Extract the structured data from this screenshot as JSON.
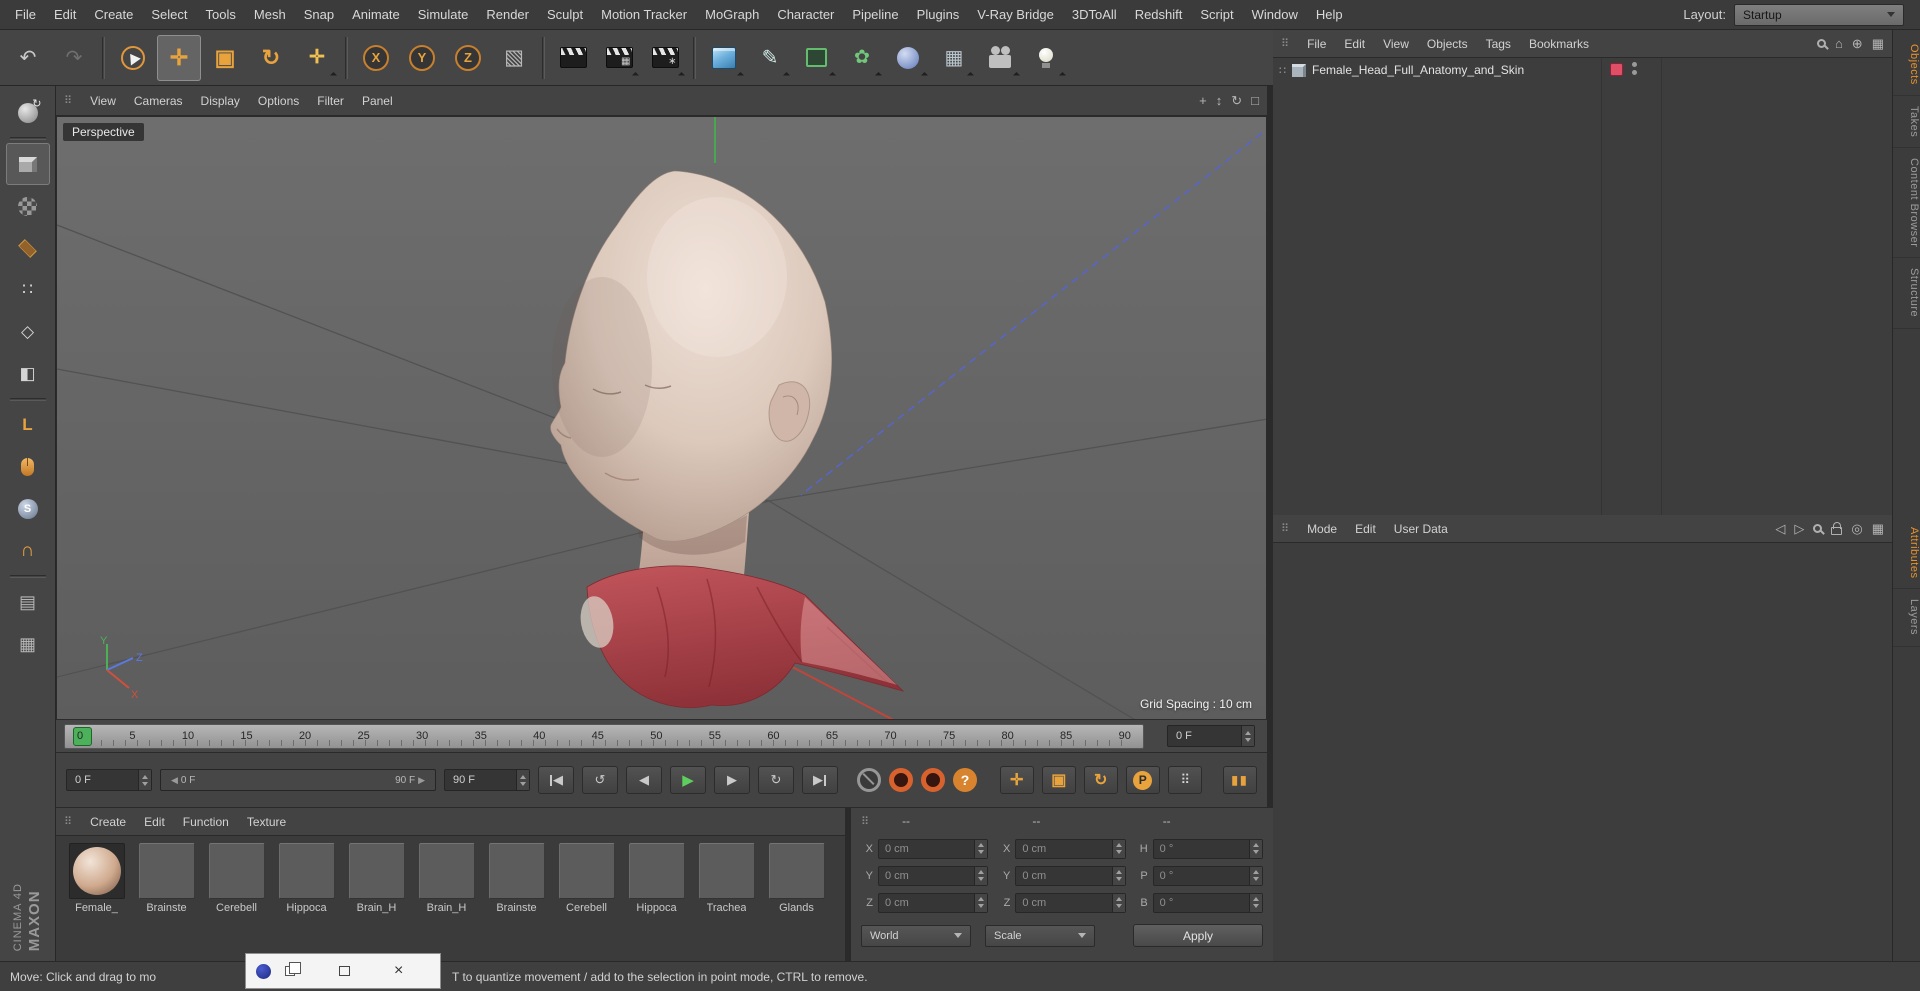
{
  "app": {
    "menubar": [
      "File",
      "Edit",
      "Create",
      "Select",
      "Tools",
      "Mesh",
      "Snap",
      "Animate",
      "Simulate",
      "Render",
      "Sculpt",
      "Motion Tracker",
      "MoGraph",
      "Character",
      "Pipeline",
      "Plugins",
      "V-Ray Bridge",
      "3DToAll",
      "Redshift",
      "Script",
      "Window",
      "Help"
    ],
    "layout_label": "Layout:",
    "layout_value": "Startup"
  },
  "colors": {
    "accent_orange": "#e8912d",
    "tool_orange": "#e8a33d",
    "record_red": "#d8622e",
    "playhead_green": "#4db05a",
    "tag_red": "#e04f66",
    "axis_green": "#4aa64f",
    "axis_blue": "#5566cc",
    "axis_red": "#c0453a"
  },
  "icons": {
    "undo": "↶",
    "redo": "↷",
    "move": "✛",
    "scale": "▣",
    "rotate": "↻",
    "last_tool": "✛",
    "axis_x": "X",
    "axis_y": "Y",
    "axis_z": "Z",
    "coord_system": "▧",
    "pen": "✎",
    "mograph": "✿",
    "floor": "▦",
    "gear": "∗",
    "picture": "▦",
    "handle": "⠿",
    "points": "∷",
    "edges": "◇",
    "polygons": "◧",
    "axis_l": "L",
    "snap_s": "S",
    "magnet": "∩",
    "gridlock": "▤",
    "gridplane": "▦",
    "pan": "+",
    "zoom": "↕",
    "orbit": "↻",
    "maximize": "□",
    "tri_left": "◀",
    "tri_right": "▶",
    "loop_left": "↺",
    "loop_right": "↻",
    "question": "?",
    "record_p": "P",
    "pla": "⠿",
    "key_bars": "▮▮",
    "nav_left": "◁",
    "nav_right": "▷",
    "circle": "◎",
    "grid": "▦",
    "home": "⌂",
    "target": "⊕",
    "expander": "∷",
    "win_close": "×"
  },
  "sidebar": {
    "brand_top": "MAXON",
    "brand_bottom": "CINEMA 4D"
  },
  "viewport": {
    "menu": [
      "View",
      "Cameras",
      "Display",
      "Options",
      "Filter",
      "Panel"
    ],
    "label": "Perspective",
    "grid_spacing": "Grid Spacing : 10 cm",
    "axis_labels": {
      "x": "X",
      "y": "Y",
      "z": "Z"
    }
  },
  "timeline": {
    "ticks": [
      "0",
      "5",
      "10",
      "15",
      "20",
      "25",
      "30",
      "35",
      "40",
      "45",
      "50",
      "55",
      "60",
      "65",
      "70",
      "75",
      "80",
      "85",
      "90"
    ],
    "frame_spinner": "0 F"
  },
  "transport": {
    "start_field": "0 F",
    "end_field": "90 F",
    "range_start": "0 F",
    "range_end": "90 F"
  },
  "materials": {
    "menu": [
      "Create",
      "Edit",
      "Function",
      "Texture"
    ],
    "sphere_material": "Female_",
    "flat_materials": [
      "Brainste",
      "Cerebell",
      "Hippoca",
      "Brain_H",
      "Brain_H",
      "Brainste",
      "Cerebell",
      "Hippoca",
      "Trachea",
      "Glands"
    ]
  },
  "coordinates": {
    "headers": [
      "--",
      "--",
      "--"
    ],
    "fields": [
      {
        "label": "X",
        "value": "0 cm"
      },
      {
        "label": "Y",
        "value": "0 cm"
      },
      {
        "label": "Z",
        "value": "0 cm"
      },
      {
        "label": "X",
        "value": "0 cm"
      },
      {
        "label": "Y",
        "value": "0 cm"
      },
      {
        "label": "Z",
        "value": "0 cm"
      },
      {
        "label": "H",
        "value": "0 °"
      },
      {
        "label": "P",
        "value": "0 °"
      },
      {
        "label": "B",
        "value": "0 °"
      }
    ],
    "world_dropdown": "World",
    "scale_dropdown": "Scale",
    "apply_button": "Apply"
  },
  "object_manager": {
    "menu": [
      "File",
      "Edit",
      "View",
      "Objects",
      "Tags",
      "Bookmarks"
    ],
    "object_name": "Female_Head_Full_Anatomy_and_Skin"
  },
  "attribute_manager": {
    "menu": [
      "Mode",
      "Edit",
      "User Data"
    ]
  },
  "right_tabs": {
    "top": [
      "Objects",
      "Takes",
      "Content Browser",
      "Structure"
    ],
    "bottom": [
      "Attributes",
      "Layers"
    ]
  },
  "statusbar": {
    "left": "Move: Click and drag to mo",
    "right": "T to quantize movement / add to the selection in point mode, CTRL to remove."
  }
}
